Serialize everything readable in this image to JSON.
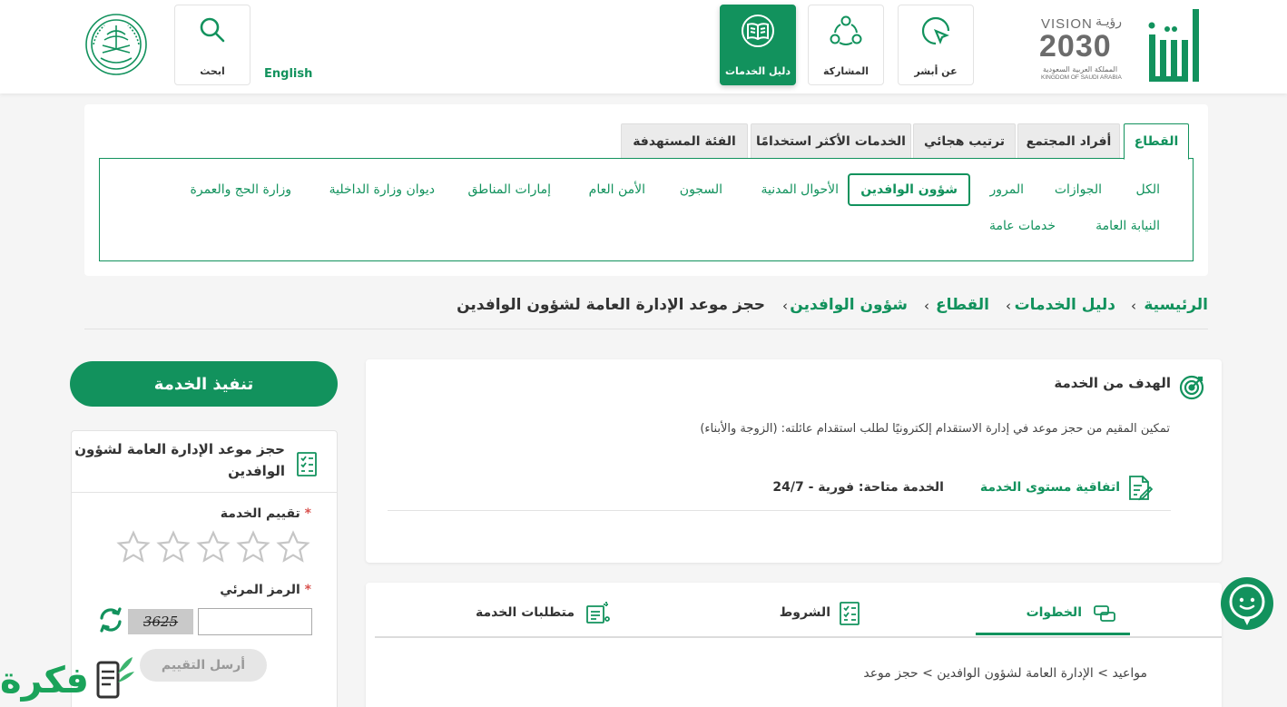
{
  "header": {
    "nav": [
      {
        "label": "عن أبشر",
        "icon": "cursor-click-icon"
      },
      {
        "label": "المشاركة",
        "icon": "people-share-icon"
      },
      {
        "label": "دليل الخدمات",
        "icon": "book-icon",
        "active": true
      }
    ],
    "search_label": "ابحث",
    "language": "English",
    "vision": {
      "vision_word": "VISION",
      "vision_ar": "رؤيـة",
      "year": "2030",
      "kingdom_ar": "المملكة العربية السعودية",
      "kingdom_en": "KINGDOM OF SAUDI ARABIA"
    },
    "absher_logo": "أبشر"
  },
  "category_tabs": [
    "القطاع",
    "أفراد المجتمع",
    "ترتيب هجائي",
    "الخدمات الأكثر استخدامًا",
    "الفئة المستهدفة"
  ],
  "sectors_row1": [
    "الكل",
    "الجوازات",
    "المرور",
    "شؤون الوافدين",
    "الأحوال المدنية",
    "السجون",
    "الأمن العام",
    "إمارات المناطق",
    "ديوان وزارة الداخلية",
    "وزارة الحج والعمرة"
  ],
  "sectors_row2": [
    "النيابة العامة",
    "خدمات عامة"
  ],
  "breadcrumb": [
    "الرئيسية",
    "دليل الخدمات",
    "القطاع",
    "شؤون الوافدين",
    "حجز موعد الإدارة العامة لشؤون الوافدين"
  ],
  "goal": {
    "title": "الهدف من الخدمة",
    "text": "تمكين المقيم من حجز موعد في إدارة الاستقدام إلكترونيًا لطلب استقدام عائلته: (الزوجة والأبناء)",
    "sla_label": "اتفاقية مستوى الخدمة",
    "availability": "الخدمة متاحة: فورية - 24/7"
  },
  "execute_button": "تنفيذ الخدمة",
  "rating": {
    "service_title_line1": "حجز موعد الإدارة العامة لشؤون",
    "service_title_line2": "الوافدين",
    "rating_label": "تقييم الخدمة",
    "stars": 5,
    "stars_selected": 0,
    "captcha_label": "الرمز المرئي",
    "captcha_text": "3625",
    "required_mark": "*",
    "send_button": "أرسل التقييم"
  },
  "bottom_tabs": [
    {
      "label": "الخطوات",
      "active": true
    },
    {
      "label": "الشروط"
    },
    {
      "label": "متطلبات الخدمة"
    }
  ],
  "steps_text": "مواعيد > الإدارة العامة لشؤون الوافدين > حجز موعد",
  "watermark": "فكرة",
  "colors": {
    "brand_green": "#12925d",
    "background": "#f5f5f5"
  }
}
